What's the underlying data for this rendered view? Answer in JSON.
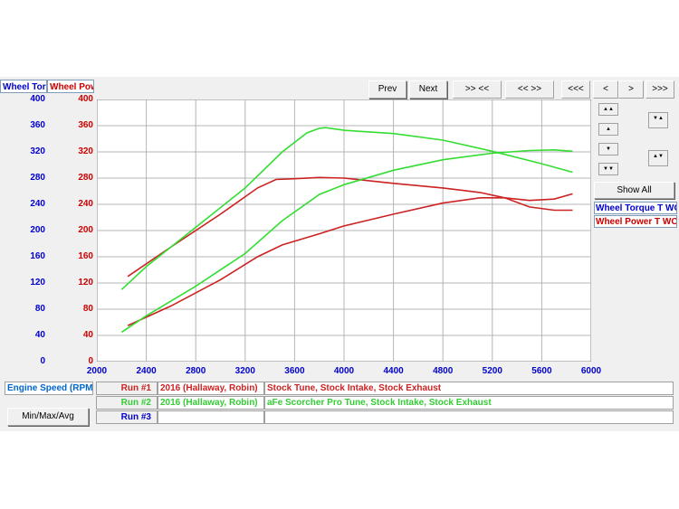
{
  "header": {
    "left_axis_title": "Wheel Torc",
    "right_axis_title": "Wheel Pow"
  },
  "toolbar": {
    "prev": "Prev",
    "next": "Next",
    "zoom_in": ">> <<",
    "zoom_out": "<< >>",
    "first": "<<<",
    "back": "<",
    "forward": ">",
    "last": ">>>"
  },
  "side": {
    "show_all": "Show All",
    "legend": [
      "Wheel Torque T WC",
      "Wheel Power T WC ("
    ]
  },
  "axes": {
    "y_ticks": [
      "400",
      "360",
      "320",
      "280",
      "240",
      "200",
      "160",
      "120",
      "80",
      "40",
      "0"
    ],
    "x_ticks": [
      "2000",
      "2400",
      "2800",
      "3200",
      "3600",
      "4000",
      "4400",
      "4800",
      "5200",
      "5600",
      "6000"
    ]
  },
  "bottom": {
    "x_axis_label": "Engine Speed (RPM)",
    "minmax_button": "Min/Max/Avg",
    "runs": [
      {
        "label": "Run #1",
        "vehicle": "2016 (Hallaway, Robin)",
        "desc": "Stock Tune, Stock Intake, Stock Exhaust"
      },
      {
        "label": "Run #2",
        "vehicle": "2016 (Hallaway, Robin)",
        "desc": "aFe Scorcher Pro Tune, Stock Intake, Stock Exhaust"
      },
      {
        "label": "Run #3",
        "vehicle": "",
        "desc": ""
      }
    ]
  },
  "colors": {
    "run1": "#cc2222",
    "run2": "#33dd33",
    "left_axis": "#0000cc",
    "right_axis": "#cc0000"
  },
  "chart_data": {
    "type": "line",
    "xlim": [
      2000,
      6000
    ],
    "ylim": [
      0,
      400
    ],
    "series": [
      {
        "name": "Run #1",
        "kind": "torque",
        "x": [
          2250,
          2600,
          3000,
          3300,
          3450,
          3600,
          3800,
          4000,
          4400,
          4800,
          5100,
          5300,
          5500,
          5700,
          5850
        ],
        "y": [
          130,
          175,
          225,
          265,
          278,
          279,
          281,
          280,
          272,
          265,
          258,
          250,
          236,
          231,
          231
        ]
      },
      {
        "name": "Run #1",
        "kind": "power",
        "x": [
          2250,
          2600,
          3000,
          3300,
          3500,
          3800,
          4000,
          4400,
          4800,
          5100,
          5300,
          5500,
          5700,
          5850
        ],
        "y": [
          55,
          85,
          125,
          160,
          178,
          195,
          207,
          225,
          242,
          250,
          250,
          246,
          248,
          256
        ]
      },
      {
        "name": "Run #2",
        "kind": "torque",
        "x": [
          2200,
          2400,
          2800,
          3200,
          3500,
          3700,
          3800,
          3850,
          4000,
          4400,
          4800,
          5200,
          5600,
          5850
        ],
        "y": [
          110,
          145,
          205,
          265,
          320,
          349,
          356,
          357,
          353,
          348,
          338,
          321,
          302,
          289
        ]
      },
      {
        "name": "Run #2",
        "kind": "power",
        "x": [
          2200,
          2400,
          2800,
          3200,
          3500,
          3800,
          4000,
          4400,
          4800,
          5200,
          5500,
          5700,
          5850
        ],
        "y": [
          45,
          70,
          115,
          165,
          215,
          255,
          270,
          292,
          308,
          318,
          322,
          323,
          321
        ]
      }
    ]
  }
}
